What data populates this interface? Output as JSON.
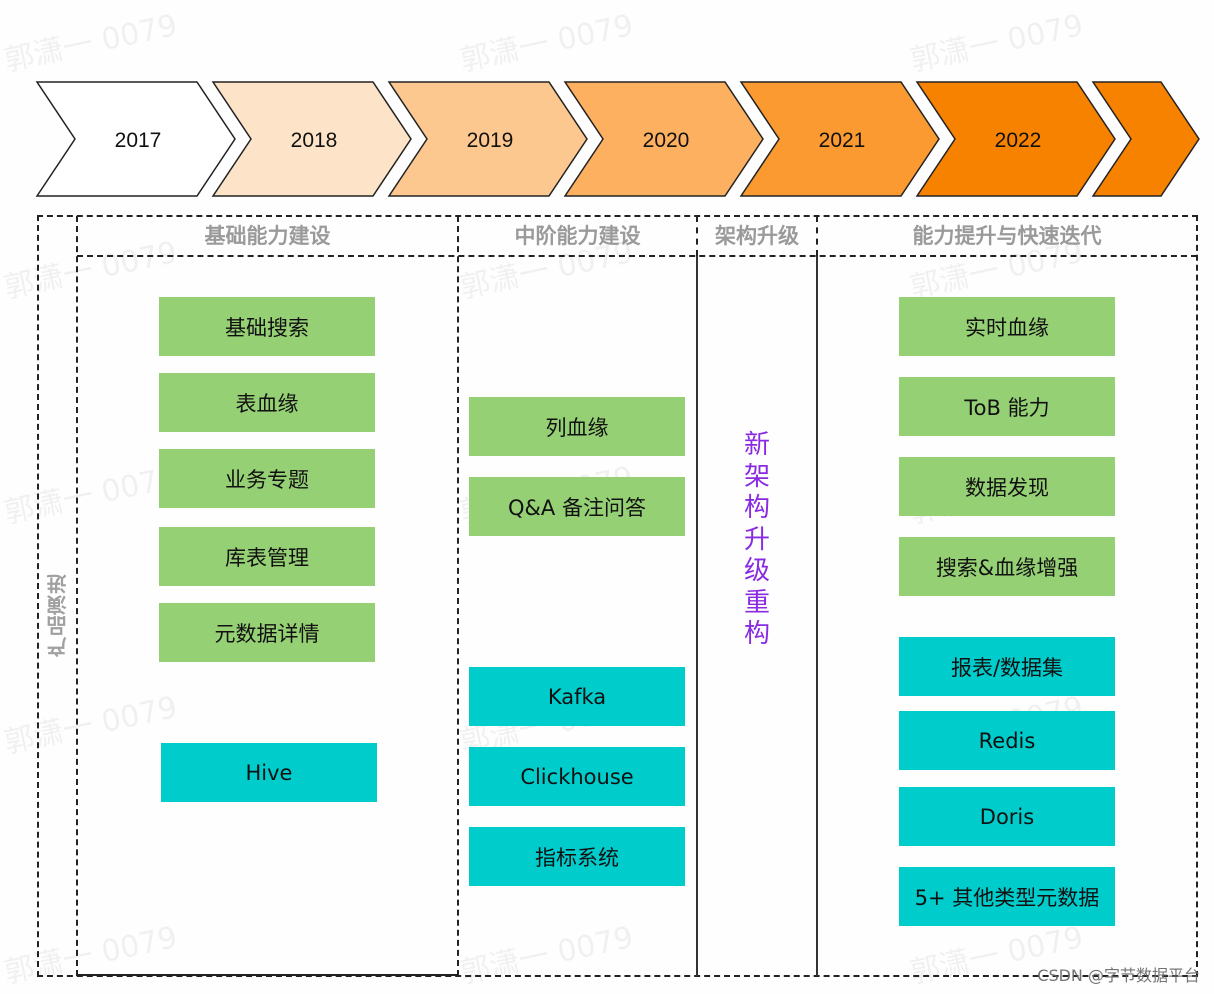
{
  "timeline": {
    "years": [
      {
        "label": "2017",
        "color": "#ffffff"
      },
      {
        "label": "2018",
        "color": "#fde3c7"
      },
      {
        "label": "2019",
        "color": "#fdc890"
      },
      {
        "label": "2020",
        "color": "#fdb060"
      },
      {
        "label": "2021",
        "color": "#fb9a30"
      },
      {
        "label": "2022",
        "color": "#f78200"
      },
      {
        "label": "",
        "color": "#f78200"
      }
    ]
  },
  "side_label": "产品演进",
  "phases": [
    {
      "title": "基础能力建设"
    },
    {
      "title": "中阶能力建设"
    },
    {
      "title": "架构升级"
    },
    {
      "title": "能力提升与快速迭代"
    }
  ],
  "columns": {
    "basic": {
      "green": [
        "基础搜索",
        "表血缘",
        "业务专题",
        "库表管理",
        "元数据详情"
      ],
      "teal": [
        "Hive"
      ]
    },
    "intermediate": {
      "green": [
        "列血缘",
        "Q&A 备注问答"
      ],
      "teal": [
        "Kafka",
        "Clickhouse",
        "指标系统"
      ]
    },
    "architecture": {
      "vertical_text": [
        "新",
        "架",
        "构",
        "升",
        "级",
        "重",
        "构"
      ]
    },
    "advanced": {
      "green": [
        "实时血缘",
        "ToB 能力",
        "数据发现",
        "搜索&血缘增强"
      ],
      "teal": [
        "报表/数据集",
        "Redis",
        "Doris",
        "5+ 其他类型元数据"
      ]
    }
  },
  "colors": {
    "green_box": "#96d075",
    "teal_box": "#00cccc",
    "phase_title": "#9a9a9a",
    "vertical_text": "#8a2be2"
  },
  "watermark": "郭潇一 0079",
  "credit": "CSDN @字节数据平台"
}
